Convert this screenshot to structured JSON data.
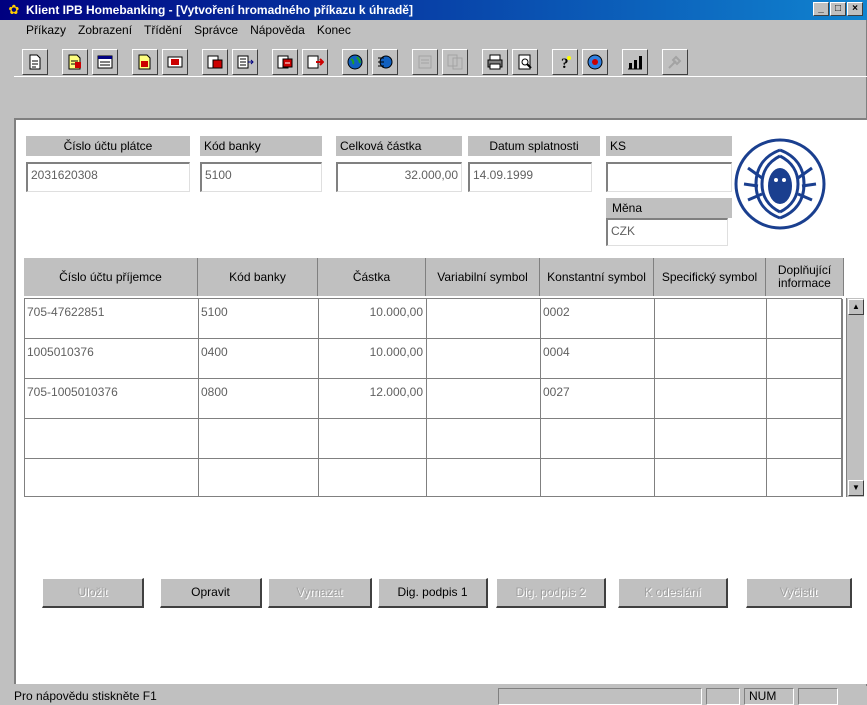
{
  "window": {
    "title": "Klient IPB Homebanking - [Vytvoření hromadného příkazu k úhradě]",
    "buttons": {
      "minimize": "_",
      "maximize": "□",
      "close": "×"
    }
  },
  "menu": [
    "Příkazy",
    "Zobrazení",
    "Třídění",
    "Správce",
    "Nápověda",
    "Konec"
  ],
  "toolbar": {
    "icons": [
      "new-document-icon",
      "edit-document-icon",
      "form-icon",
      "folder-import-icon",
      "delete-icon",
      "list-export-icon",
      "list-arrow-icon",
      "transfer-red-icon",
      "export-red-icon",
      "globe-icon",
      "globe-network-icon",
      "disabled-list-icon",
      "disabled-copy-icon",
      "print-icon",
      "print-preview-icon",
      "help-icon",
      "settings-globe-icon",
      "statistics-icon",
      "disabled-tool-icon"
    ]
  },
  "header": {
    "payer_account_label": "Číslo účtu plátce",
    "payer_account_value": "2031620308",
    "bank_code_label": "Kód banky",
    "bank_code_value": "5100",
    "total_amount_label": "Celková částka",
    "total_amount_value": "32.000,00",
    "due_date_label": "Datum splatnosti",
    "due_date_value": "14.09.1999",
    "ks_label": "KS",
    "ks_value": "",
    "currency_label": "Měna",
    "currency_value": "CZK"
  },
  "table": {
    "columns": [
      "Číslo účtu příjemce",
      "Kód banky",
      "Částka",
      "Variabilní symbol",
      "Konstantní symbol",
      "Specifický symbol",
      "Doplňující informace"
    ],
    "rows": [
      [
        "705-47622851",
        "5100",
        "10.000,00",
        "",
        "0002",
        "",
        ""
      ],
      [
        "1005010376",
        "0400",
        "10.000,00",
        "",
        "0004",
        "",
        ""
      ],
      [
        "705-1005010376",
        "0800",
        "12.000,00",
        "",
        "0027",
        "",
        ""
      ],
      [
        "",
        "",
        "",
        "",
        "",
        "",
        ""
      ],
      [
        "",
        "",
        "",
        "",
        "",
        "",
        ""
      ]
    ]
  },
  "buttons": {
    "save": "Uložit",
    "edit": "Opravit",
    "delete": "Vymazat",
    "sign1": "Dig. podpis 1",
    "sign2": "Dig. podpis 2",
    "to_send": "K odeslání",
    "clear": "Vyčistit"
  },
  "status": {
    "message": "Pro nápovědu stiskněte F1",
    "num": "NUM"
  }
}
